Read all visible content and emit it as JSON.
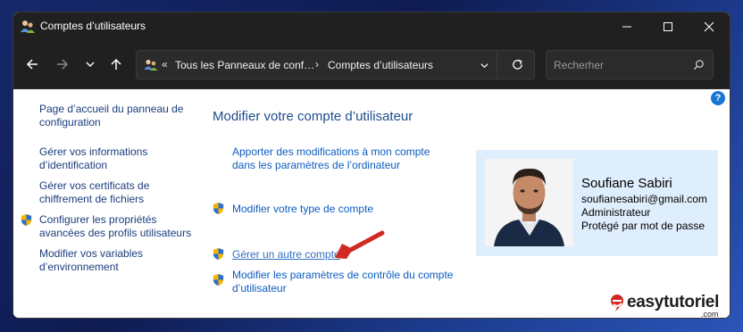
{
  "window": {
    "title": "Comptes d’utilisateurs"
  },
  "titlebar": {
    "minimize_icon": "minimize-icon",
    "maximize_icon": "maximize-icon",
    "close_icon": "close-icon"
  },
  "nav": {
    "back_icon": "back-arrow-icon",
    "forward_icon": "forward-arrow-icon",
    "recent_icon": "chevron-down-icon",
    "up_icon": "up-arrow-icon"
  },
  "address": {
    "prefix": "«",
    "crumbs": [
      "Tous les Panneaux de conf…",
      "Comptes d’utilisateurs"
    ],
    "separator": "›"
  },
  "search": {
    "placeholder": "Recherher"
  },
  "sidebar": {
    "items": [
      {
        "label": "Page d’accueil du panneau de configuration",
        "line1": "Page d’accueil du panneau de",
        "line2": "configuration"
      },
      {
        "line1": "Gérer vos informations",
        "line2": "d’identification"
      },
      {
        "line1": "Gérer vos certificats de",
        "line2": "chiffrement de fichiers"
      },
      {
        "line1": "Configurer les propriétés",
        "line2": "avancées des profils utilisateurs"
      },
      {
        "line1": "Modifier vos variables",
        "line2": "d’environnement"
      }
    ]
  },
  "main": {
    "title": "Modifier votre compte d’utilisateur",
    "tasks": [
      {
        "line1": "Apporter des modifications à mon compte",
        "line2": "dans les paramètres de l’ordinateur"
      },
      {
        "line1": "Modifier votre type de compte"
      },
      {
        "line1": "Gérer un autre compte"
      },
      {
        "line1": "Modifier les paramètres de contrôle du compte",
        "line2": "d’utilisateur"
      }
    ]
  },
  "user": {
    "name": "Soufiane Sabiri",
    "email": "soufianesabiri@gmail.com",
    "role": "Administrateur",
    "protection": "Protégé par mot de passe"
  },
  "help": {
    "label": "?"
  },
  "watermark": {
    "text": "easytutoriel",
    "suffix": ".com"
  },
  "colors": {
    "link": "#1a3d7c",
    "task_link": "#0b5cbf",
    "title_blue": "#1e4d8c",
    "card_bg": "#dfeefc",
    "arrow_red": "#d12a22",
    "chrome_dark": "#202020"
  }
}
